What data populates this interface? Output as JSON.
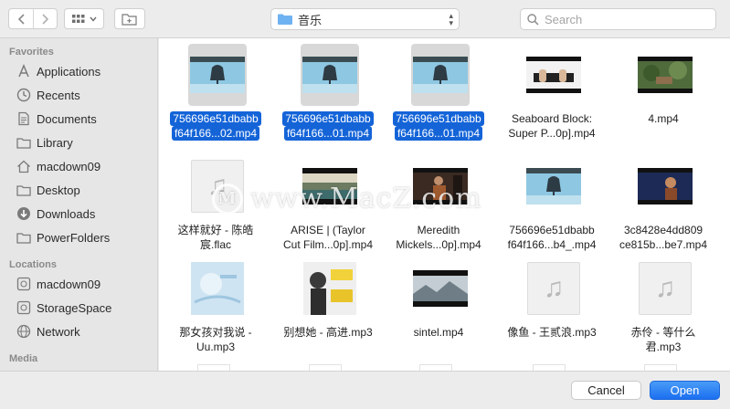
{
  "toolbar": {
    "back_icon": "chevron-left",
    "forward_icon": "chevron-right",
    "view_icon": "icon-grid",
    "new_folder_icon": "folder-plus",
    "location": "音乐",
    "search_placeholder": "Search"
  },
  "sidebar": {
    "favorites_title": "Favorites",
    "favorites": [
      {
        "label": "Applications",
        "icon": "applications-icon"
      },
      {
        "label": "Recents",
        "icon": "clock-icon"
      },
      {
        "label": "Documents",
        "icon": "document-icon"
      },
      {
        "label": "Library",
        "icon": "folder-icon"
      },
      {
        "label": "macdown09",
        "icon": "home-icon"
      },
      {
        "label": "Desktop",
        "icon": "desktop-icon"
      },
      {
        "label": "Downloads",
        "icon": "download-icon"
      },
      {
        "label": "PowerFolders",
        "icon": "folder-icon"
      }
    ],
    "locations_title": "Locations",
    "locations": [
      {
        "label": "macdown09",
        "icon": "disk-icon"
      },
      {
        "label": "StorageSpace",
        "icon": "disk-icon"
      },
      {
        "label": "Network",
        "icon": "globe-icon"
      }
    ],
    "media_title": "Media"
  },
  "files": [
    {
      "line1": "756696e51dbabb",
      "line2": "f64f166...02.mp4",
      "kind": "bell",
      "selected": true
    },
    {
      "line1": "756696e51dbabb",
      "line2": "f64f166...01.mp4",
      "kind": "bell",
      "selected": true
    },
    {
      "line1": "756696e51dbabb",
      "line2": "f64f166...01.mp4",
      "kind": "bell",
      "selected": true
    },
    {
      "line1": "Seaboard Block:",
      "line2": "Super P...0p].mp4",
      "kind": "piano",
      "selected": false
    },
    {
      "line1": "4.mp4",
      "line2": "",
      "kind": "forest",
      "selected": false
    },
    {
      "line1": "这样就好 - 陈皓",
      "line2": "宸.flac",
      "kind": "audio",
      "selected": false
    },
    {
      "line1": "ARISE | (Taylor",
      "line2": "Cut Film...0p].mp4",
      "kind": "lake",
      "selected": false
    },
    {
      "line1": "Meredith",
      "line2": "Mickels...0p].mp4",
      "kind": "dark",
      "selected": false
    },
    {
      "line1": "756696e51dbabb",
      "line2": "f64f166...b4_.mp4",
      "kind": "bell",
      "selected": false
    },
    {
      "line1": "3c8428e4dd809",
      "line2": "ce815b...be7.mp4",
      "kind": "stage",
      "selected": false
    },
    {
      "line1": "那女孩对我说 -",
      "line2": "Uu.mp3",
      "kind": "cover-blue",
      "selected": false
    },
    {
      "line1": "别想她 - 高进.mp3",
      "line2": "",
      "kind": "cover-man",
      "selected": false
    },
    {
      "line1": "sintel.mp4",
      "line2": "",
      "kind": "snow",
      "selected": false
    },
    {
      "line1": "像鱼 - 王贰浪.mp3",
      "line2": "",
      "kind": "audio",
      "selected": false
    },
    {
      "line1": "赤伶 - 等什么",
      "line2": "君.mp3",
      "kind": "audio",
      "selected": false
    }
  ],
  "watermark": "www.MacZ.com",
  "watermark_logo": "M",
  "footer": {
    "cancel": "Cancel",
    "open": "Open"
  },
  "colors": {
    "selection": "#1464d8",
    "accent": "#1b6ff0",
    "sidebar_bg": "#e6e6e6"
  }
}
